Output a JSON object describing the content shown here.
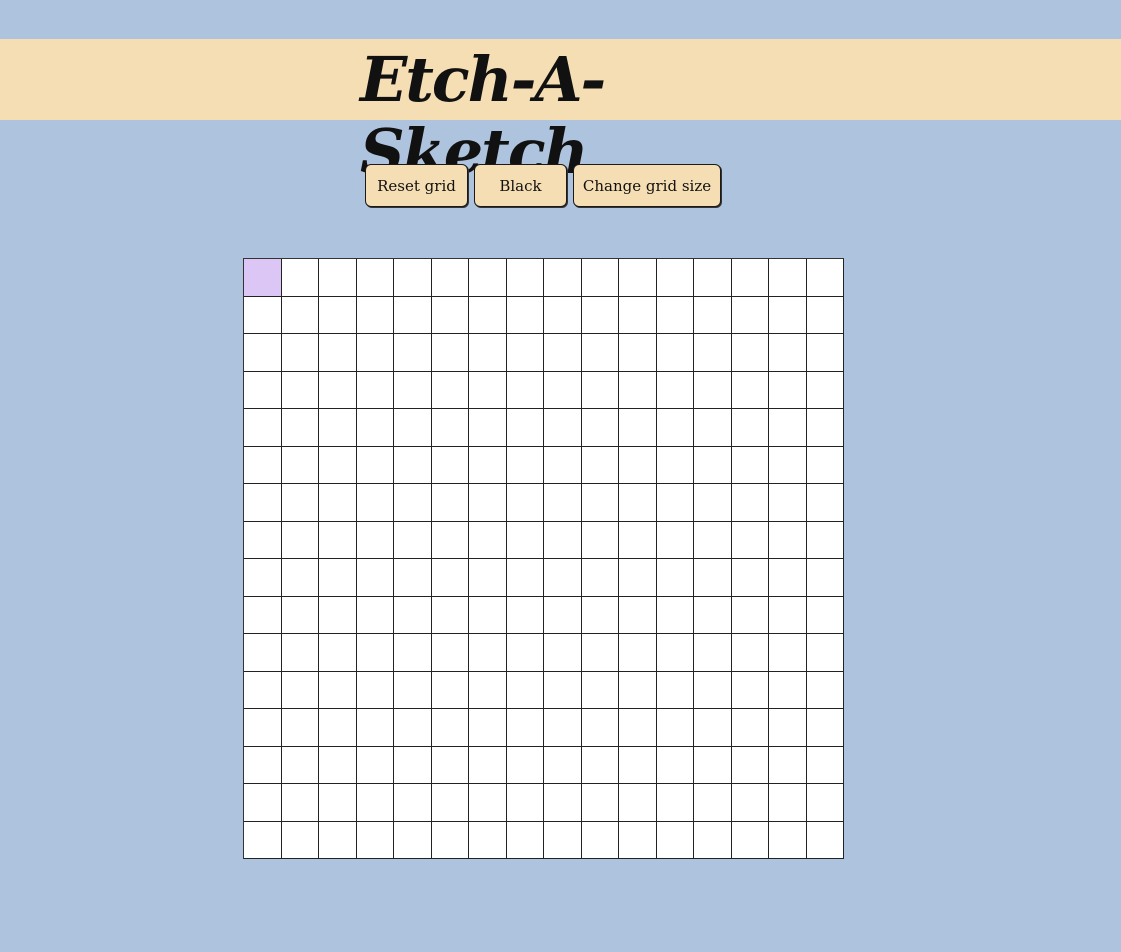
{
  "app": {
    "title": "Etch-A-Sketch"
  },
  "controls": {
    "reset_label": "Reset grid",
    "color_label": "Black",
    "size_label": "Change grid size"
  },
  "grid": {
    "rows": 16,
    "cols": 16,
    "filled_cells": [
      {
        "row": 0,
        "col": 0,
        "color": "#dcc6f5"
      }
    ]
  },
  "colors": {
    "background": "#aec3dd",
    "header": "#f5deb3",
    "button": "#f5deb3",
    "cell_default": "#ffffff"
  }
}
